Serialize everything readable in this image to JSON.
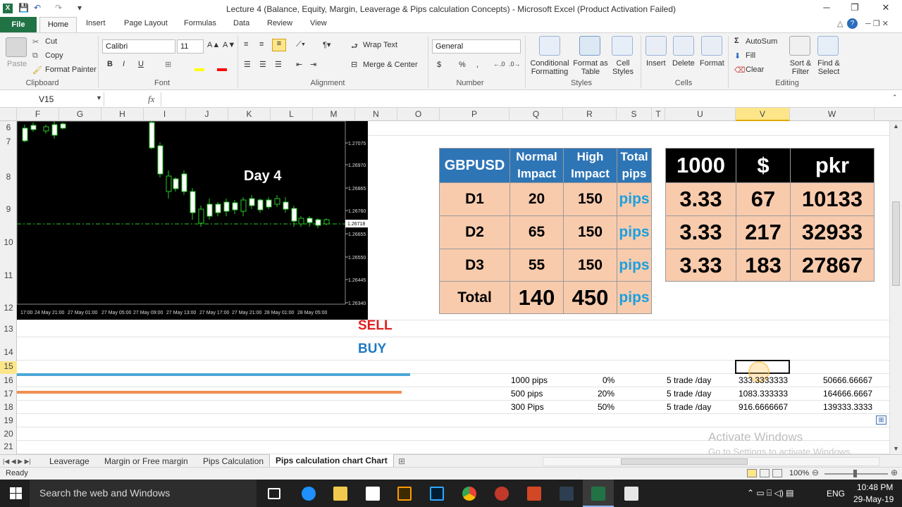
{
  "window": {
    "title": "Lecture 4 (Balance, Equity, Margin, Leaverage & Pips calculation Concepts)  -  Microsoft Excel (Product Activation Failed)",
    "minimize": "─",
    "maximize": "❐",
    "close": "✕"
  },
  "ribbon_tabs": [
    "File",
    "Home",
    "Insert",
    "Page Layout",
    "Formulas",
    "Data",
    "Review",
    "View"
  ],
  "ribbon": {
    "clipboard": {
      "paste": "Paste",
      "cut": "Cut",
      "copy": "Copy",
      "format_painter": "Format Painter",
      "label": "Clipboard"
    },
    "font": {
      "name": "Calibri",
      "size": "11",
      "bold": "B",
      "italic": "I",
      "underline": "U",
      "label": "Font"
    },
    "alignment": {
      "wrap": "Wrap Text",
      "merge": "Merge & Center",
      "label": "Alignment"
    },
    "number": {
      "format": "General",
      "currency": "$",
      "percent": "%",
      "comma": ",",
      "label": "Number"
    },
    "styles": {
      "conditional": "Conditional Formatting",
      "format_table": "Format as Table",
      "cell_styles": "Cell Styles",
      "label": "Styles"
    },
    "cells": {
      "insert": "Insert",
      "delete": "Delete",
      "format": "Format",
      "label": "Cells"
    },
    "editing": {
      "autosum": "AutoSum",
      "fill": "Fill",
      "clear": "Clear",
      "sort": "Sort & Filter",
      "find": "Find & Select",
      "label": "Editing"
    }
  },
  "formula_bar": {
    "name_box": "V15",
    "fx": "fx",
    "value": ""
  },
  "columns": [
    "F",
    "G",
    "H",
    "I",
    "J",
    "K",
    "L",
    "M",
    "N",
    "O",
    "P",
    "Q",
    "R",
    "S",
    "T",
    "U",
    "V",
    "W"
  ],
  "rows": [
    "6",
    "7",
    "8",
    "9",
    "10",
    "11",
    "12",
    "13",
    "14",
    "15",
    "16",
    "17",
    "18",
    "19",
    "20",
    "21"
  ],
  "chart": {
    "annotation": "Day 4",
    "current_price": "1.26718",
    "price_labels": [
      "1.27075",
      "1.26970",
      "1.26865",
      "1.26760",
      "1.26655",
      "1.26550",
      "1.26445",
      "1.26340"
    ],
    "time_labels": [
      "17:00",
      "24 May 21:00",
      "27 May 01:00",
      "27 May 05:00",
      "27 May 09:00",
      "27 May 13:00",
      "27 May 17:00",
      "27 May 21:00",
      "28 May 01:00",
      "28 May 05:00"
    ],
    "up_color": "#ffffff",
    "line_color": "#27c927"
  },
  "labels": {
    "sell": "SELL",
    "buy": "BUY"
  },
  "impact_table": {
    "headers": [
      "GBPUSD",
      "Normal Impact",
      "High Impact",
      "Total pips"
    ],
    "rows": [
      {
        "pair": "D1",
        "normal": "20",
        "high": "150",
        "unit": "pips"
      },
      {
        "pair": "D2",
        "normal": "65",
        "high": "150",
        "unit": "pips"
      },
      {
        "pair": "D3",
        "normal": "55",
        "high": "150",
        "unit": "pips"
      },
      {
        "pair": "Total",
        "normal": "140",
        "high": "450",
        "unit": "pips"
      }
    ]
  },
  "conversion_table": {
    "headers": [
      "1000",
      "$",
      "pkr"
    ],
    "rows": [
      [
        "3.33",
        "67",
        "10133"
      ],
      [
        "3.33",
        "217",
        "32933"
      ],
      [
        "3.33",
        "183",
        "27867"
      ]
    ]
  },
  "small_table": {
    "rows": [
      {
        "pips": "1000 pips",
        "pct": "0%",
        "trades": "5 trade /day",
        "v": "333.3333333",
        "w": "50666.66667"
      },
      {
        "pips": "500 pips",
        "pct": "20%",
        "trades": "5 trade /day",
        "v": "1083.333333",
        "w": "164666.6667"
      },
      {
        "pips": "300 Pips",
        "pct": "50%",
        "trades": "5 trade /day",
        "v": "916.6666667",
        "w": "139333.3333"
      }
    ]
  },
  "watermark": {
    "line1": "Activate Windows",
    "line2": "Go to Settings to activate Windows."
  },
  "sheet_tabs": [
    "Leaverage",
    "Margin or Free margin",
    "Pips Calculation",
    "Pips calculation chart Chart"
  ],
  "status": {
    "ready": "Ready",
    "zoom": "100%"
  },
  "taskbar": {
    "search": "Search the web and Windows",
    "lang": "ENG",
    "time": "10:48 PM",
    "date": "29-May-19"
  }
}
